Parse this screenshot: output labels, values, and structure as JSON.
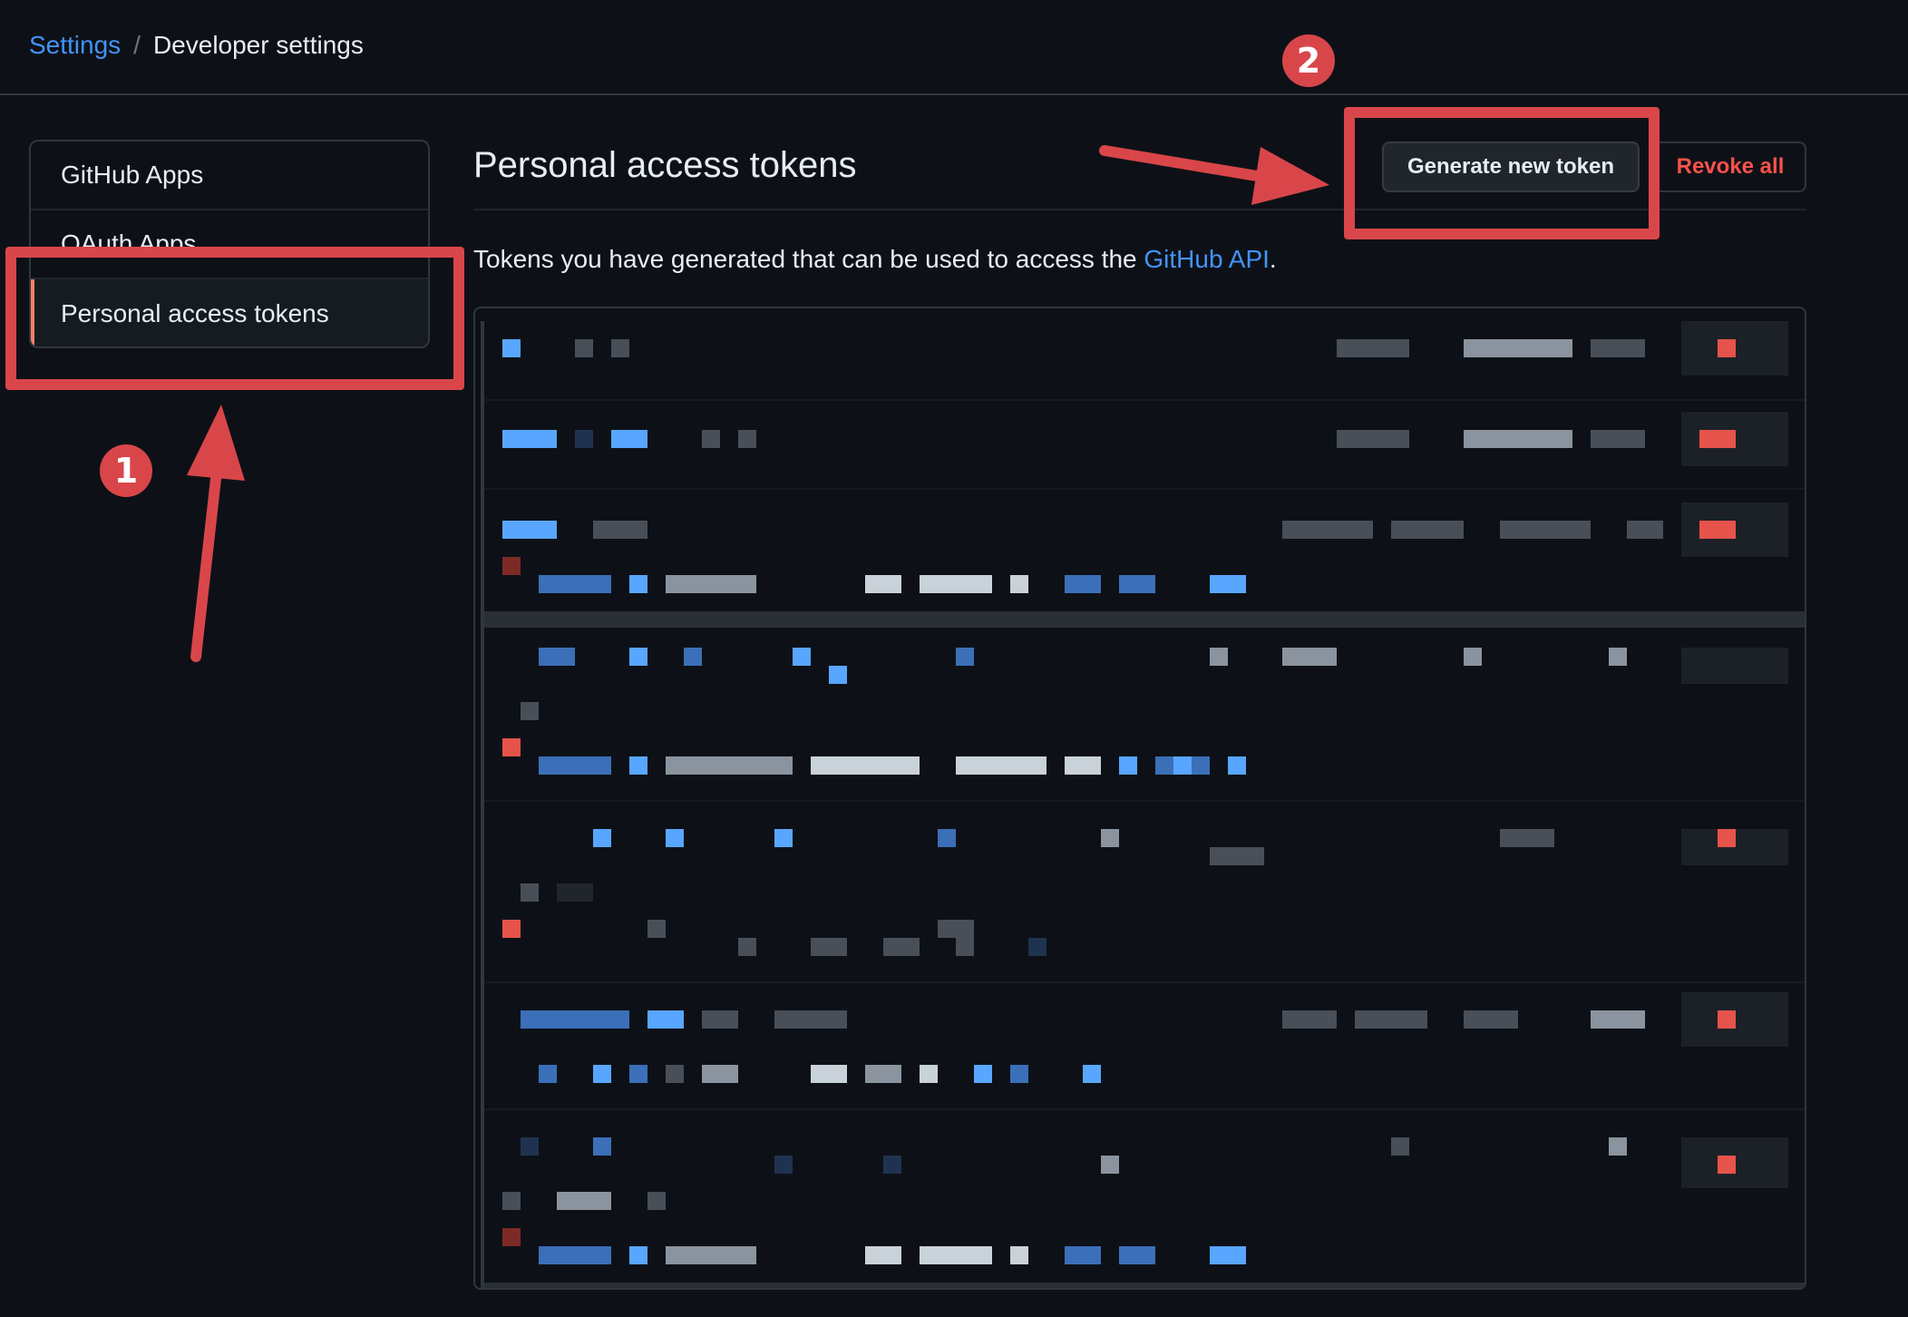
{
  "breadcrumb": {
    "settings": "Settings",
    "separator": "/",
    "current": "Developer settings"
  },
  "sidebar": {
    "items": [
      {
        "label": "GitHub Apps"
      },
      {
        "label": "OAuth Apps"
      },
      {
        "label": "Personal access tokens"
      }
    ],
    "selected": "Personal access tokens"
  },
  "main": {
    "title": "Personal access tokens",
    "generate_button": "Generate new token",
    "revoke_button": "Revoke all",
    "description_prefix": "Tokens you have generated that can be used to access the ",
    "description_link": "GitHub API",
    "description_suffix": "."
  },
  "annotations": {
    "step1": "1",
    "step2": "2",
    "color": "#d9464a"
  },
  "colors": {
    "background": "#0d1117",
    "link": "#4493f8",
    "danger": "#f85149",
    "selected_indicator": "#f78166"
  }
}
